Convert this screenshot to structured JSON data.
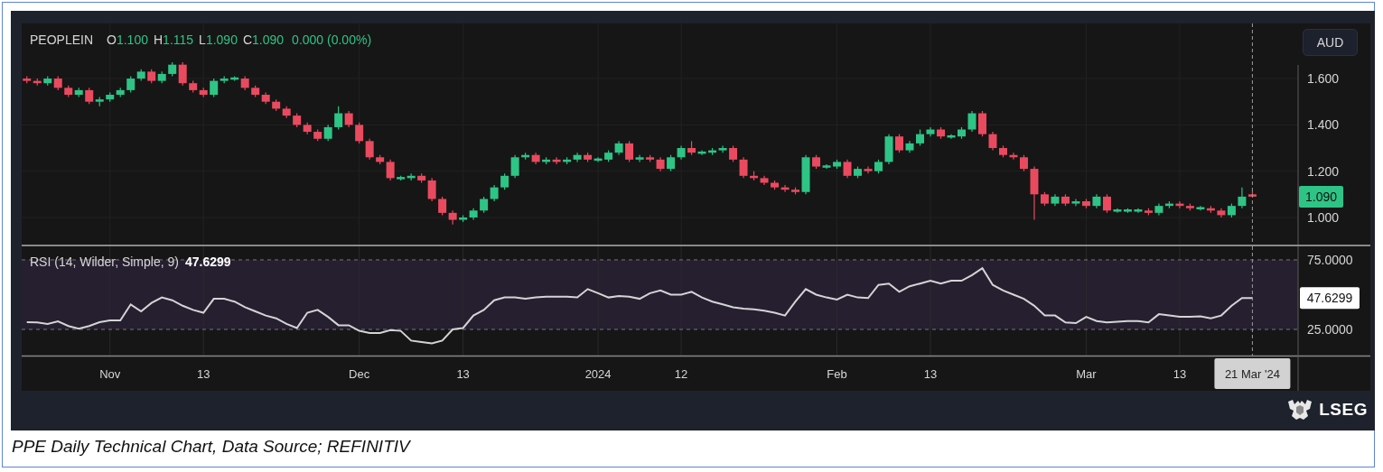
{
  "price_pane": {
    "legend": {
      "symbol": "PEOPLEIN",
      "fields": [
        {
          "label": "O",
          "value": "1.100"
        },
        {
          "label": "H",
          "value": "1.115"
        },
        {
          "label": "L",
          "value": "1.090"
        },
        {
          "label": "C",
          "value": "1.090"
        }
      ],
      "change": "0.000 (0.00%)"
    },
    "currency": "AUD",
    "last_price": "1.090",
    "chart_data": {
      "type": "candlestick",
      "grid": true,
      "ylim": [
        0.883,
        1.838
      ],
      "yticks": [
        {
          "value": 1.6,
          "label": "1.600"
        },
        {
          "value": 1.4,
          "label": "1.400"
        },
        {
          "value": 1.2,
          "label": "1.200"
        },
        {
          "value": 1.0,
          "label": "1.000"
        }
      ],
      "categories": [
        null,
        null,
        null,
        null,
        null,
        null,
        null,
        null,
        null,
        null,
        null,
        null,
        null,
        null,
        null,
        null,
        null,
        null,
        null,
        null,
        null,
        null,
        null,
        null,
        null,
        null,
        null,
        null,
        null,
        null,
        null,
        null,
        null,
        null,
        null,
        null,
        null,
        null,
        null,
        null,
        null,
        null,
        null,
        null,
        null,
        null,
        null,
        null,
        null,
        null,
        null,
        null,
        null,
        null,
        null,
        null,
        null,
        null,
        null,
        null,
        null,
        null,
        null,
        null,
        null,
        null,
        null,
        null,
        null,
        null,
        null,
        null,
        null,
        null,
        null,
        null,
        null,
        null,
        null,
        null,
        null,
        null,
        null,
        null,
        null,
        null,
        null,
        null,
        null,
        null,
        null,
        null,
        null,
        null,
        null,
        null,
        null,
        null,
        null,
        null,
        null,
        null,
        null,
        null,
        null,
        null,
        null,
        null,
        null,
        null,
        null,
        null,
        null,
        null,
        null,
        null,
        null,
        null,
        null
      ],
      "ohlc": [
        [
          1.6,
          1.61,
          1.58,
          1.59
        ],
        [
          1.59,
          1.6,
          1.57,
          1.58
        ],
        [
          1.58,
          1.61,
          1.57,
          1.6
        ],
        [
          1.6,
          1.61,
          1.55,
          1.56
        ],
        [
          1.56,
          1.57,
          1.52,
          1.53
        ],
        [
          1.53,
          1.56,
          1.52,
          1.55
        ],
        [
          1.55,
          1.56,
          1.49,
          1.5
        ],
        [
          1.5,
          1.52,
          1.48,
          1.51
        ],
        [
          1.51,
          1.54,
          1.5,
          1.53
        ],
        [
          1.53,
          1.56,
          1.52,
          1.55
        ],
        [
          1.55,
          1.61,
          1.54,
          1.6
        ],
        [
          1.6,
          1.64,
          1.59,
          1.63
        ],
        [
          1.63,
          1.64,
          1.58,
          1.59
        ],
        [
          1.59,
          1.63,
          1.58,
          1.62
        ],
        [
          1.62,
          1.67,
          1.61,
          1.66
        ],
        [
          1.66,
          1.67,
          1.57,
          1.58
        ],
        [
          1.58,
          1.59,
          1.54,
          1.55
        ],
        [
          1.55,
          1.56,
          1.52,
          1.53
        ],
        [
          1.53,
          1.6,
          1.52,
          1.59
        ],
        [
          1.59,
          1.61,
          1.58,
          1.6
        ],
        [
          1.6,
          1.61,
          1.59,
          1.6
        ],
        [
          1.6,
          1.61,
          1.55,
          1.56
        ],
        [
          1.56,
          1.57,
          1.52,
          1.53
        ],
        [
          1.53,
          1.54,
          1.49,
          1.5
        ],
        [
          1.5,
          1.51,
          1.46,
          1.47
        ],
        [
          1.47,
          1.48,
          1.43,
          1.44
        ],
        [
          1.44,
          1.45,
          1.39,
          1.4
        ],
        [
          1.4,
          1.41,
          1.36,
          1.37
        ],
        [
          1.37,
          1.38,
          1.33,
          1.34
        ],
        [
          1.34,
          1.4,
          1.33,
          1.39
        ],
        [
          1.39,
          1.48,
          1.38,
          1.45
        ],
        [
          1.45,
          1.46,
          1.39,
          1.4
        ],
        [
          1.4,
          1.41,
          1.32,
          1.33
        ],
        [
          1.33,
          1.34,
          1.25,
          1.26
        ],
        [
          1.26,
          1.27,
          1.23,
          1.24
        ],
        [
          1.24,
          1.25,
          1.16,
          1.17
        ],
        [
          1.17,
          1.18,
          1.16,
          1.17
        ],
        [
          1.17,
          1.19,
          1.16,
          1.18
        ],
        [
          1.18,
          1.19,
          1.15,
          1.16
        ],
        [
          1.16,
          1.17,
          1.07,
          1.08
        ],
        [
          1.08,
          1.09,
          1.01,
          1.02
        ],
        [
          1.02,
          1.03,
          0.97,
          0.99
        ],
        [
          0.99,
          1.01,
          0.98,
          1.0
        ],
        [
          1.0,
          1.04,
          0.99,
          1.03
        ],
        [
          1.03,
          1.09,
          1.02,
          1.08
        ],
        [
          1.08,
          1.14,
          1.07,
          1.13
        ],
        [
          1.13,
          1.19,
          1.12,
          1.18
        ],
        [
          1.18,
          1.27,
          1.17,
          1.26
        ],
        [
          1.26,
          1.28,
          1.25,
          1.27
        ],
        [
          1.27,
          1.28,
          1.23,
          1.24
        ],
        [
          1.24,
          1.26,
          1.23,
          1.25
        ],
        [
          1.25,
          1.26,
          1.23,
          1.24
        ],
        [
          1.24,
          1.26,
          1.23,
          1.25
        ],
        [
          1.25,
          1.28,
          1.24,
          1.27
        ],
        [
          1.27,
          1.28,
          1.24,
          1.25
        ],
        [
          1.25,
          1.26,
          1.24,
          1.25
        ],
        [
          1.25,
          1.29,
          1.24,
          1.28
        ],
        [
          1.28,
          1.33,
          1.27,
          1.32
        ],
        [
          1.32,
          1.33,
          1.24,
          1.25
        ],
        [
          1.25,
          1.27,
          1.24,
          1.26
        ],
        [
          1.26,
          1.27,
          1.24,
          1.25
        ],
        [
          1.25,
          1.26,
          1.2,
          1.21
        ],
        [
          1.21,
          1.27,
          1.2,
          1.26
        ],
        [
          1.26,
          1.31,
          1.25,
          1.3
        ],
        [
          1.3,
          1.33,
          1.27,
          1.28
        ],
        [
          1.28,
          1.29,
          1.27,
          1.28
        ],
        [
          1.28,
          1.3,
          1.27,
          1.29
        ],
        [
          1.29,
          1.31,
          1.28,
          1.3
        ],
        [
          1.3,
          1.31,
          1.24,
          1.25
        ],
        [
          1.25,
          1.26,
          1.17,
          1.18
        ],
        [
          1.18,
          1.2,
          1.16,
          1.17
        ],
        [
          1.17,
          1.18,
          1.14,
          1.15
        ],
        [
          1.15,
          1.16,
          1.12,
          1.13
        ],
        [
          1.13,
          1.14,
          1.11,
          1.12
        ],
        [
          1.12,
          1.13,
          1.1,
          1.11
        ],
        [
          1.11,
          1.27,
          1.1,
          1.26
        ],
        [
          1.26,
          1.27,
          1.21,
          1.22
        ],
        [
          1.22,
          1.23,
          1.21,
          1.22
        ],
        [
          1.22,
          1.25,
          1.21,
          1.24
        ],
        [
          1.24,
          1.25,
          1.17,
          1.18
        ],
        [
          1.18,
          1.22,
          1.17,
          1.21
        ],
        [
          1.21,
          1.22,
          1.19,
          1.2
        ],
        [
          1.2,
          1.25,
          1.19,
          1.24
        ],
        [
          1.24,
          1.36,
          1.23,
          1.35
        ],
        [
          1.35,
          1.36,
          1.28,
          1.29
        ],
        [
          1.29,
          1.33,
          1.28,
          1.32
        ],
        [
          1.32,
          1.38,
          1.31,
          1.36
        ],
        [
          1.36,
          1.39,
          1.35,
          1.38
        ],
        [
          1.38,
          1.39,
          1.34,
          1.35
        ],
        [
          1.35,
          1.36,
          1.34,
          1.35
        ],
        [
          1.35,
          1.39,
          1.34,
          1.38
        ],
        [
          1.38,
          1.46,
          1.37,
          1.45
        ],
        [
          1.45,
          1.46,
          1.35,
          1.36
        ],
        [
          1.36,
          1.37,
          1.29,
          1.3
        ],
        [
          1.3,
          1.31,
          1.26,
          1.27
        ],
        [
          1.27,
          1.28,
          1.25,
          1.26
        ],
        [
          1.26,
          1.27,
          1.2,
          1.21
        ],
        [
          1.21,
          1.22,
          0.99,
          1.1
        ],
        [
          1.1,
          1.11,
          1.05,
          1.06
        ],
        [
          1.06,
          1.1,
          1.05,
          1.09
        ],
        [
          1.09,
          1.1,
          1.05,
          1.06
        ],
        [
          1.06,
          1.08,
          1.05,
          1.07
        ],
        [
          1.07,
          1.08,
          1.04,
          1.05
        ],
        [
          1.05,
          1.1,
          1.04,
          1.09
        ],
        [
          1.09,
          1.1,
          1.02,
          1.03
        ],
        [
          1.03,
          1.04,
          1.02,
          1.03
        ],
        [
          1.03,
          1.04,
          1.02,
          1.03
        ],
        [
          1.03,
          1.04,
          1.02,
          1.03
        ],
        [
          1.03,
          1.04,
          1.01,
          1.02
        ],
        [
          1.02,
          1.06,
          1.01,
          1.05
        ],
        [
          1.05,
          1.07,
          1.04,
          1.06
        ],
        [
          1.06,
          1.07,
          1.04,
          1.05
        ],
        [
          1.05,
          1.06,
          1.03,
          1.04
        ],
        [
          1.04,
          1.05,
          1.03,
          1.04
        ],
        [
          1.04,
          1.05,
          1.02,
          1.03
        ],
        [
          1.03,
          1.04,
          1.0,
          1.01
        ],
        [
          1.01,
          1.06,
          1.0,
          1.05
        ],
        [
          1.05,
          1.13,
          1.04,
          1.09
        ],
        [
          1.1,
          1.115,
          1.09,
          1.09
        ]
      ]
    }
  },
  "rsi_pane": {
    "legend_value": "47.6299",
    "last_value": "47.6299",
    "crosshair_date": "21 Mar '24",
    "chart_data": {
      "type": "line",
      "grid": true,
      "ylim": [
        6.2,
        84.7
      ],
      "categories": [
        null,
        null,
        null,
        null,
        null,
        null,
        null,
        null,
        "Nov",
        null,
        null,
        null,
        null,
        null,
        null,
        null,
        null,
        "13",
        null,
        null,
        null,
        null,
        null,
        null,
        null,
        null,
        null,
        null,
        null,
        null,
        null,
        null,
        "Dec",
        null,
        null,
        null,
        null,
        null,
        null,
        null,
        null,
        null,
        "13",
        null,
        null,
        null,
        null,
        null,
        null,
        null,
        null,
        null,
        null,
        null,
        null,
        "2024",
        null,
        null,
        null,
        null,
        null,
        null,
        null,
        "12",
        null,
        null,
        null,
        null,
        null,
        null,
        null,
        null,
        null,
        null,
        null,
        null,
        null,
        null,
        "Feb",
        null,
        null,
        null,
        null,
        null,
        null,
        null,
        null,
        "13",
        null,
        null,
        null,
        null,
        null,
        null,
        null,
        null,
        null,
        null,
        null,
        null,
        null,
        null,
        "Mar",
        null,
        null,
        null,
        null,
        null,
        null,
        null,
        null,
        "13",
        null,
        null,
        null,
        null,
        null,
        null,
        null
      ],
      "yticks": [
        {
          "value": 75,
          "label": "75.0000"
        },
        {
          "value": 25,
          "label": "25.0000"
        }
      ],
      "series": [
        {
          "name": "RSI (14, Wilder, Simple, 9)",
          "color": "#d4d4d4",
          "values": [
            30.2,
            30,
            28.9,
            30.8,
            27.5,
            25.5,
            27.5,
            30.2,
            31.5,
            31.5,
            43,
            38,
            44,
            48,
            46,
            42,
            39,
            37,
            47,
            47,
            45,
            41,
            38,
            35,
            33,
            29,
            26,
            37,
            39,
            34,
            28,
            28,
            24,
            22.5,
            22.5,
            24.5,
            24,
            17,
            16,
            15,
            17,
            25,
            26,
            35,
            39,
            46,
            48,
            48,
            47,
            48,
            48.5,
            48.5,
            48.5,
            48,
            54,
            51,
            48,
            49,
            48.5,
            47,
            51,
            53,
            50,
            50,
            52,
            48,
            45,
            43,
            41,
            40,
            39.5,
            38.5,
            37,
            35,
            45,
            54,
            50,
            48,
            46.5,
            50,
            48,
            47.5,
            57,
            58,
            52,
            56,
            58,
            60,
            58,
            60,
            60,
            64,
            69,
            57,
            53,
            50,
            47,
            42,
            35,
            35,
            30,
            29.5,
            34,
            31,
            30,
            30.5,
            31,
            31,
            30,
            36,
            35,
            34,
            34,
            34.5,
            33,
            35,
            42,
            47.6,
            47.6
          ]
        }
      ]
    }
  },
  "logo": "LSEG",
  "caption": "PPE Daily Technical Chart, Data Source; REFINITIV"
}
